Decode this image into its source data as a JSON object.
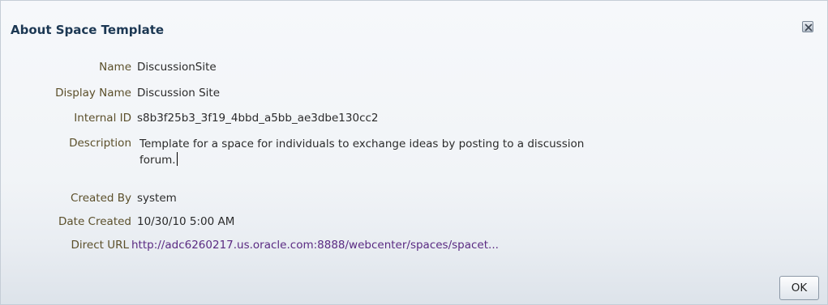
{
  "dialog": {
    "title": "About Space Template",
    "close_icon": "close-icon"
  },
  "fields": {
    "name": {
      "label": "Name",
      "value": "DiscussionSite"
    },
    "display_name": {
      "label": "Display Name",
      "value": "Discussion Site"
    },
    "internal_id": {
      "label": "Internal ID",
      "value": "s8b3f25b3_3f19_4bbd_a5bb_ae3dbe130cc2"
    },
    "description": {
      "label": "Description",
      "value_line1": "Template for a space for individuals to exchange ideas by posting to a discussion",
      "value_line2": "forum."
    },
    "created_by": {
      "label": "Created By",
      "value": "system"
    },
    "date_created": {
      "label": "Date Created",
      "value": "10/30/10 5:00 AM"
    },
    "direct_url": {
      "label": "Direct URL",
      "value": "http://adc6260217.us.oracle.com:8888/webcenter/spaces/spacet..."
    }
  },
  "footer": {
    "ok_label": "OK"
  },
  "colors": {
    "title": "#1c3853",
    "label": "#5b4f2a",
    "link": "#5a2a82"
  }
}
